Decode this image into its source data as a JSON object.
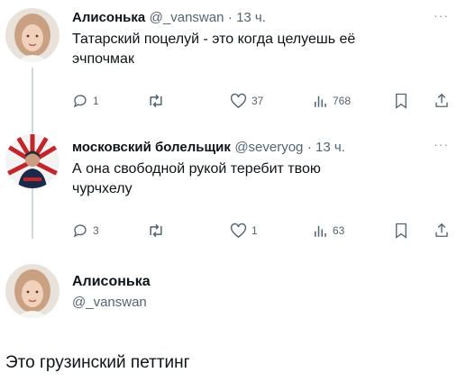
{
  "tweet1": {
    "author": "Алисонька",
    "handle": "@_vanswan",
    "time": "· 13 ч.",
    "text_line1": "Татарский поцелуй - это когда целуешь её",
    "text_line2": "эчпочмак",
    "replies": "1",
    "retweets": "",
    "likes": "37",
    "views": "768"
  },
  "tweet2": {
    "author": "московский болельщик",
    "handle": "@severyog",
    "time": "· 13 ч.",
    "text_line1": "А она свободной рукой теребит твою",
    "text_line2": "чурчхелу",
    "replies": "3",
    "retweets": "",
    "likes": "1",
    "views": "63"
  },
  "tweet3": {
    "author": "Алисонька",
    "handle": "@_vanswan",
    "text": "Это грузинский петтинг"
  },
  "more_label": "···",
  "icons": [
    "reply-icon",
    "retweet-icon",
    "like-icon",
    "views-icon",
    "bookmark-icon",
    "share-icon"
  ]
}
